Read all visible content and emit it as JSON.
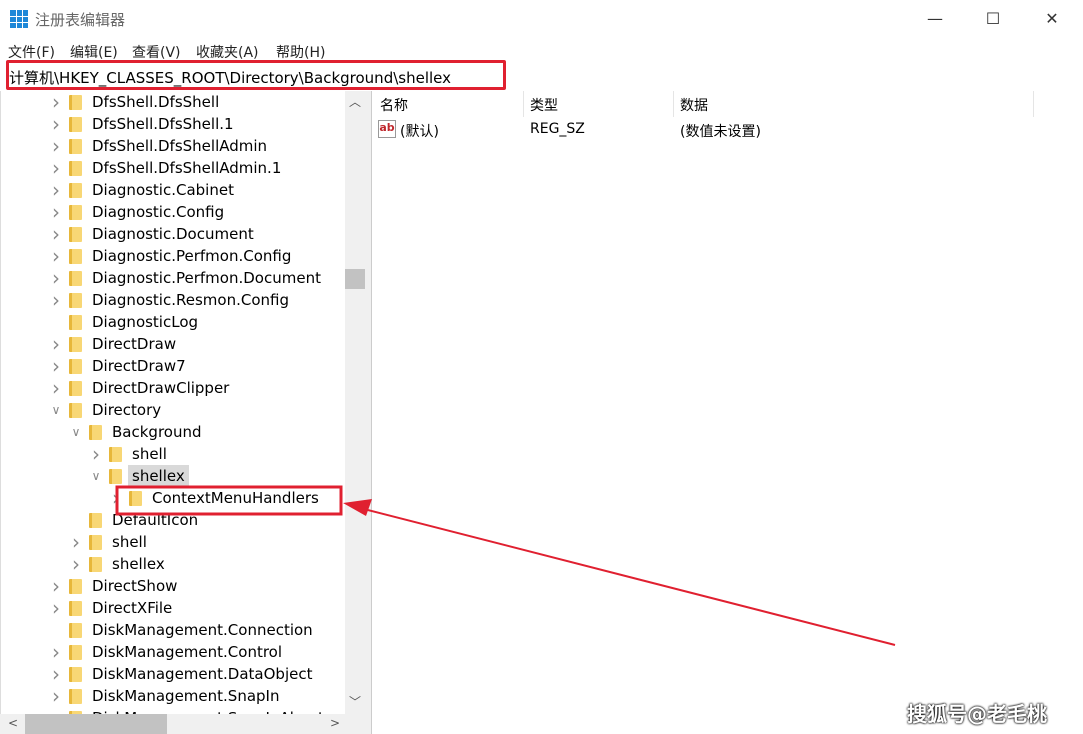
{
  "window": {
    "title": "注册表编辑器",
    "minimize": "—",
    "maximize": "☐",
    "close": "✕"
  },
  "menu": [
    "文件(F)",
    "编辑(E)",
    "查看(V)",
    "收藏夹(A)",
    "帮助(H)"
  ],
  "address": "计算机\\HKEY_CLASSES_ROOT\\Directory\\Background\\shellex",
  "tree": [
    {
      "label": "DfsShell.DfsShell",
      "level": 0,
      "state": "collapsed"
    },
    {
      "label": "DfsShell.DfsShell.1",
      "level": 0,
      "state": "collapsed"
    },
    {
      "label": "DfsShell.DfsShellAdmin",
      "level": 0,
      "state": "collapsed"
    },
    {
      "label": "DfsShell.DfsShellAdmin.1",
      "level": 0,
      "state": "collapsed"
    },
    {
      "label": "Diagnostic.Cabinet",
      "level": 0,
      "state": "collapsed"
    },
    {
      "label": "Diagnostic.Config",
      "level": 0,
      "state": "collapsed"
    },
    {
      "label": "Diagnostic.Document",
      "level": 0,
      "state": "collapsed"
    },
    {
      "label": "Diagnostic.Perfmon.Config",
      "level": 0,
      "state": "collapsed"
    },
    {
      "label": "Diagnostic.Perfmon.Document",
      "level": 0,
      "state": "collapsed"
    },
    {
      "label": "Diagnostic.Resmon.Config",
      "level": 0,
      "state": "collapsed"
    },
    {
      "label": "DiagnosticLog",
      "level": 0,
      "state": "leaf"
    },
    {
      "label": "DirectDraw",
      "level": 0,
      "state": "collapsed"
    },
    {
      "label": "DirectDraw7",
      "level": 0,
      "state": "collapsed"
    },
    {
      "label": "DirectDrawClipper",
      "level": 0,
      "state": "collapsed"
    },
    {
      "label": "Directory",
      "level": 0,
      "state": "expanded"
    },
    {
      "label": "Background",
      "level": 1,
      "state": "expanded"
    },
    {
      "label": "shell",
      "level": 2,
      "state": "collapsed"
    },
    {
      "label": "shellex",
      "level": 2,
      "state": "expanded",
      "selected": true
    },
    {
      "label": "ContextMenuHandlers",
      "level": 3,
      "state": "collapsed"
    },
    {
      "label": "DefaultIcon",
      "level": 1,
      "state": "leaf"
    },
    {
      "label": "shell",
      "level": 1,
      "state": "collapsed"
    },
    {
      "label": "shellex",
      "level": 1,
      "state": "collapsed"
    },
    {
      "label": "DirectShow",
      "level": 0,
      "state": "collapsed"
    },
    {
      "label": "DirectXFile",
      "level": 0,
      "state": "collapsed"
    },
    {
      "label": "DiskManagement.Connection",
      "level": 0,
      "state": "leaf"
    },
    {
      "label": "DiskManagement.Control",
      "level": 0,
      "state": "collapsed"
    },
    {
      "label": "DiskManagement.DataObject",
      "level": 0,
      "state": "collapsed"
    },
    {
      "label": "DiskManagement.SnapIn",
      "level": 0,
      "state": "collapsed"
    },
    {
      "label": "DiskManagement.SnapInAbout",
      "level": 0,
      "state": "collapsed"
    }
  ],
  "columns": {
    "name": "名称",
    "type": "类型",
    "data": "数据"
  },
  "values": [
    {
      "name": "(默认)",
      "type": "REG_SZ",
      "data": "(数值未设置)",
      "icon": "ab"
    }
  ],
  "annotation_color": "#e02030",
  "watermark": "搜狐号@老毛桃"
}
